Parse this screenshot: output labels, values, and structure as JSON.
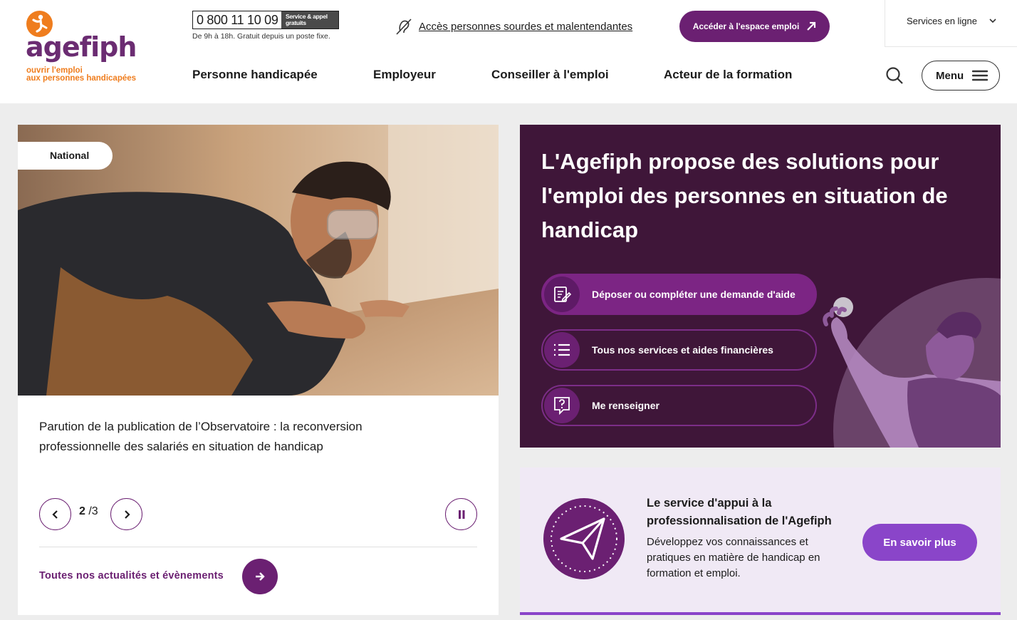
{
  "logo": {
    "name": "agefiph",
    "tagline_line1": "ouvrir l'emploi",
    "tagline_line2": "aux personnes handicapées"
  },
  "phone": {
    "number": "0 800 11 10 09",
    "tag_line1": "Service & appel",
    "tag_line2": "gratuits",
    "hours": "De 9h à 18h. Gratuit depuis un poste fixe."
  },
  "accessibility": {
    "label": "Accès personnes sourdes et malentendantes"
  },
  "cta_espace": {
    "label": "Accéder à l'espace emploi"
  },
  "services_online": {
    "label": "Services en ligne"
  },
  "nav": [
    "Personne handicapée",
    "Employeur",
    "Conseiller à l'emploi",
    "Acteur de la formation"
  ],
  "menu": {
    "label": "Menu"
  },
  "news": {
    "badge": "National",
    "title": "Parution de la publication de l’Observatoire : la reconversion professionnelle des salariés en situation de handicap",
    "pager_current": "2",
    "pager_total": "/3",
    "all_link": "Toutes nos actualités et évènements"
  },
  "hero": {
    "title": "L'Agefiph propose des solutions pour l'emploi des personnes en situation de handicap",
    "buttons": [
      {
        "label": "Déposer ou compléter une demande d'aide",
        "icon": "form-edit-icon"
      },
      {
        "label": "Tous nos services et aides financières",
        "icon": "list-icon"
      },
      {
        "label": "Me renseigner",
        "icon": "question-bubble-icon"
      }
    ]
  },
  "pro": {
    "title": "Le service d'appui à la professionnalisation de l'Agefiph",
    "text": "Développez vos connaissances et pratiques en matière de handicap en formation et emploi.",
    "button": "En savoir plus"
  },
  "colors": {
    "purple": "#6b2072",
    "dark_purple": "#3f1639",
    "orange": "#ef7d1e",
    "violet": "#8a45c9"
  }
}
